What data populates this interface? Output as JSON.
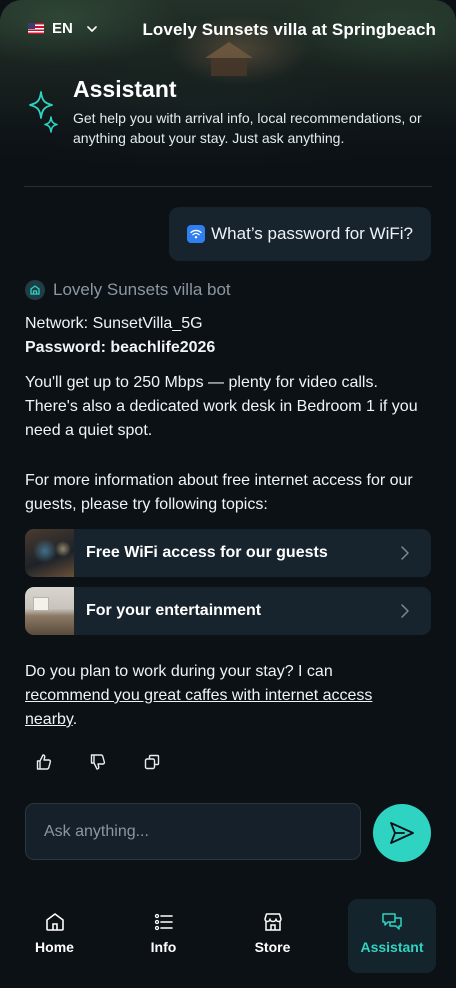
{
  "header": {
    "language": "EN",
    "villa_title": "Lovely Sunsets villa at Springbeach",
    "assistant_title": "Assistant",
    "assistant_subtitle": "Get help you with arrival info, local recommendations, or anything about your stay. Just ask anything."
  },
  "chat": {
    "user_message": "What’s password for WiFi?",
    "bot_name": "Lovely Sunsets villa bot",
    "network_line": "Network: SunsetVilla_5G",
    "password_line": "Password: beachlife2026",
    "speed_text": "You'll get up to 250 Mbps — plenty for video calls. There's also a dedicated work desk in Bedroom 1 if you need a quiet spot.",
    "more_info_text": "For more information about free internet access for our guests, please try following topics:",
    "topics": [
      {
        "label": "Free WiFi access for our guests"
      },
      {
        "label": "For your entertainment"
      }
    ],
    "work_prefix": "Do you plan to work during your stay? I can ",
    "work_link": "recommend you great caffes with internet access nearby",
    "work_suffix": "."
  },
  "composer": {
    "placeholder": "Ask anything..."
  },
  "nav": {
    "items": [
      {
        "label": "Home",
        "icon": "home-icon"
      },
      {
        "label": "Info",
        "icon": "list-icon"
      },
      {
        "label": "Store",
        "icon": "store-icon"
      },
      {
        "label": "Assistant",
        "icon": "chat-icon"
      }
    ]
  },
  "colors": {
    "accent": "#2fd3c2",
    "background": "#0c1116",
    "card": "#17232d"
  }
}
